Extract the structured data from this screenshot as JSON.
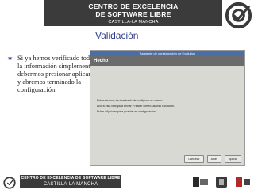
{
  "header": {
    "line1": "CENTRO DE EXCELENCIA",
    "line2": "DE SOFTWARE LIBRE",
    "line3": "CASTILLA-LA MANCHA"
  },
  "slide": {
    "title": "Validación",
    "bullet": "Si ya hemos verificado toda la información simplemente debermos presionar aplicar y abremos terminado la configuración."
  },
  "window": {
    "title": "Asistente de configuración de Evolution",
    "section": "Hecho",
    "messages": [
      "Enhorabuena, ha terminado de configurar su correo.",
      "Ahora está listo para enviar y recibir correo usando Evolution.",
      "Pulse «Aplicar» para guardar su configuración."
    ],
    "buttons": {
      "cancel": "Cancelar",
      "back": "Atrás",
      "apply": "Aplicar"
    }
  },
  "footer": {
    "line1": "CENTRO DE EXCELENCIA DE SOFTWARE LIBRE",
    "line2": "CASTILLA-LA MANCHA"
  },
  "colors": {
    "header_band": "#3b3b3b",
    "title": "#2f3b8c",
    "window_band": "#6b6b6b"
  }
}
